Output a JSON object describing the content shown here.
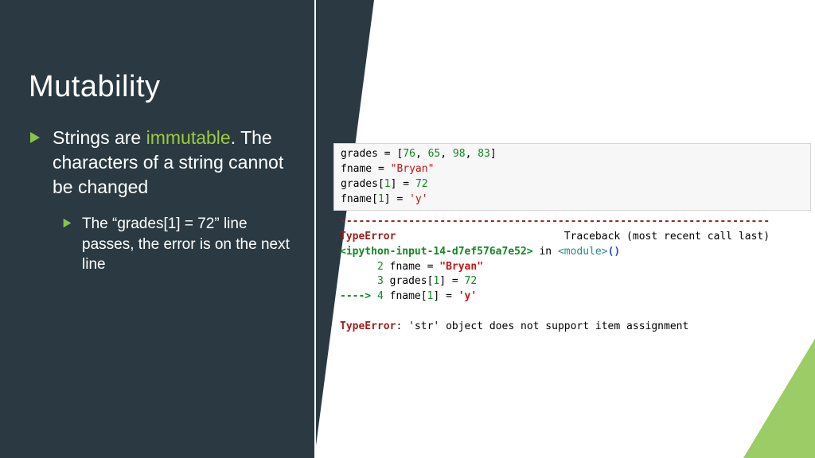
{
  "title": "Mutability",
  "bullet1": {
    "pre": "Strings are ",
    "highlight": "immutable",
    "post": ". The characters of a string cannot be changed"
  },
  "bullet2": "The “grades[1] = 72” line passes, the error is on the next line",
  "code": {
    "l1": {
      "a": "grades ",
      "eq": "=",
      "b": " [",
      "n1": "76",
      "c1": ", ",
      "n2": "65",
      "c2": ", ",
      "n3": "98",
      "c3": ", ",
      "n4": "83",
      "d": "]"
    },
    "l2": {
      "a": "fname ",
      "eq": "=",
      "b": " ",
      "s": "\"Bryan\""
    },
    "l3": {
      "a": "grades[",
      "idx": "1",
      "b": "] ",
      "eq": "=",
      "c": " ",
      "val": "72"
    },
    "l4": {
      "a": "fname[",
      "idx": "1",
      "b": "] ",
      "eq": "=",
      "c": " ",
      "val": "'y'"
    }
  },
  "trace": {
    "dash": "---------------------------------------------------------------------",
    "err": "TypeError",
    "tb": "Traceback (most recent call last)",
    "loc1": "<ipython-input-14-d7ef576a7e52>",
    "loc2": " in ",
    "loc3": "<module>",
    "loc4": "()",
    "ln2": "      2",
    "ln2code_a": " fname ",
    "ln2code_eq": "=",
    "ln2code_b": " ",
    "ln2code_s": "\"Bryan\"",
    "ln3": "      3",
    "ln3a": " grades[",
    "ln3idx": "1",
    "ln3b": "] ",
    "ln3eq": "=",
    "ln3c": " ",
    "ln3v": "72",
    "arrow": "----> ",
    "ln4n": "4",
    "ln4a": " fname[",
    "ln4idx": "1",
    "ln4b": "] ",
    "ln4eq": "=",
    "ln4c": " ",
    "ln4v": "'y'",
    "final1": "TypeError",
    "final2": ": 'str' object does not support item assignment"
  }
}
